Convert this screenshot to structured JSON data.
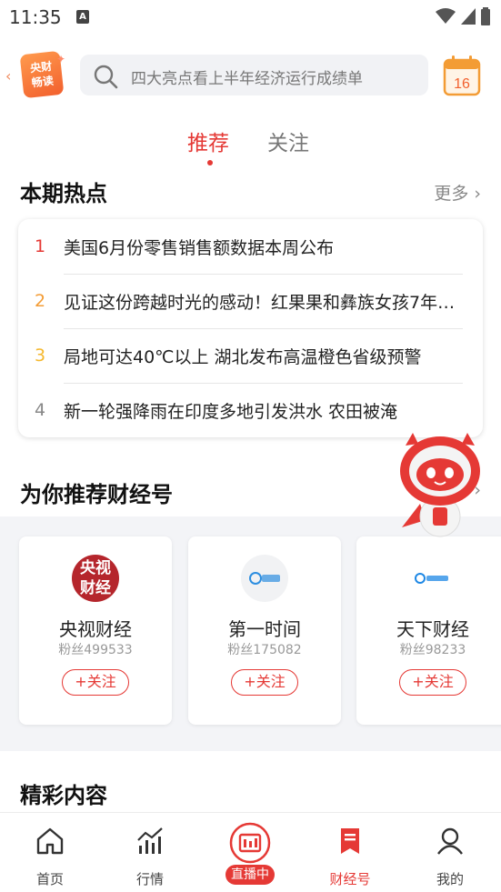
{
  "status_bar": {
    "time": "11:35"
  },
  "header": {
    "brand_lines": [
      "央财",
      "畅读"
    ],
    "search_placeholder": "四大亮点看上半年经济运行成绩单",
    "calendar_day": "16"
  },
  "tabs": [
    {
      "label": "推荐",
      "active": true
    },
    {
      "label": "关注",
      "active": false
    }
  ],
  "hot_section": {
    "title": "本期热点",
    "more_label": "更多",
    "items": [
      {
        "rank": "1",
        "rank_color": "#e53935",
        "title": "美国6月份零售销售额数据本周公布"
      },
      {
        "rank": "2",
        "rank_color": "#f39c35",
        "title": "见证这份跨越时光的感动！红果果和彝族女孩7年后重逢"
      },
      {
        "rank": "3",
        "rank_color": "#f5b82e",
        "title": "局地可达40℃以上 湖北发布高温橙色省级预警"
      },
      {
        "rank": "4",
        "rank_color": "#888888",
        "title": "新一轮强降雨在印度多地引发洪水 农田被淹"
      }
    ]
  },
  "recommend_section": {
    "title": "为你推荐财经号",
    "accounts": [
      {
        "name": "央视财经",
        "fans": "粉丝499533",
        "follow_label": "+关注",
        "avatar_text": "央视财经"
      },
      {
        "name": "第一时间",
        "fans": "粉丝175082",
        "follow_label": "+关注",
        "avatar_text": "第一时间"
      },
      {
        "name": "天下财经",
        "fans": "粉丝98233",
        "follow_label": "+关注",
        "avatar_text": "天下财经"
      }
    ]
  },
  "featured_section": {
    "title": "精彩内容"
  },
  "bottom_nav": [
    {
      "label": "首页",
      "icon": "home-icon"
    },
    {
      "label": "行情",
      "icon": "chart-icon"
    },
    {
      "label": "直播中",
      "icon": "live-tv-icon"
    },
    {
      "label": "财经号",
      "icon": "bookmark-icon",
      "active": true
    },
    {
      "label": "我的",
      "icon": "profile-icon"
    }
  ],
  "colors": {
    "accent": "#e53935",
    "brand_orange": "#f2602e"
  }
}
